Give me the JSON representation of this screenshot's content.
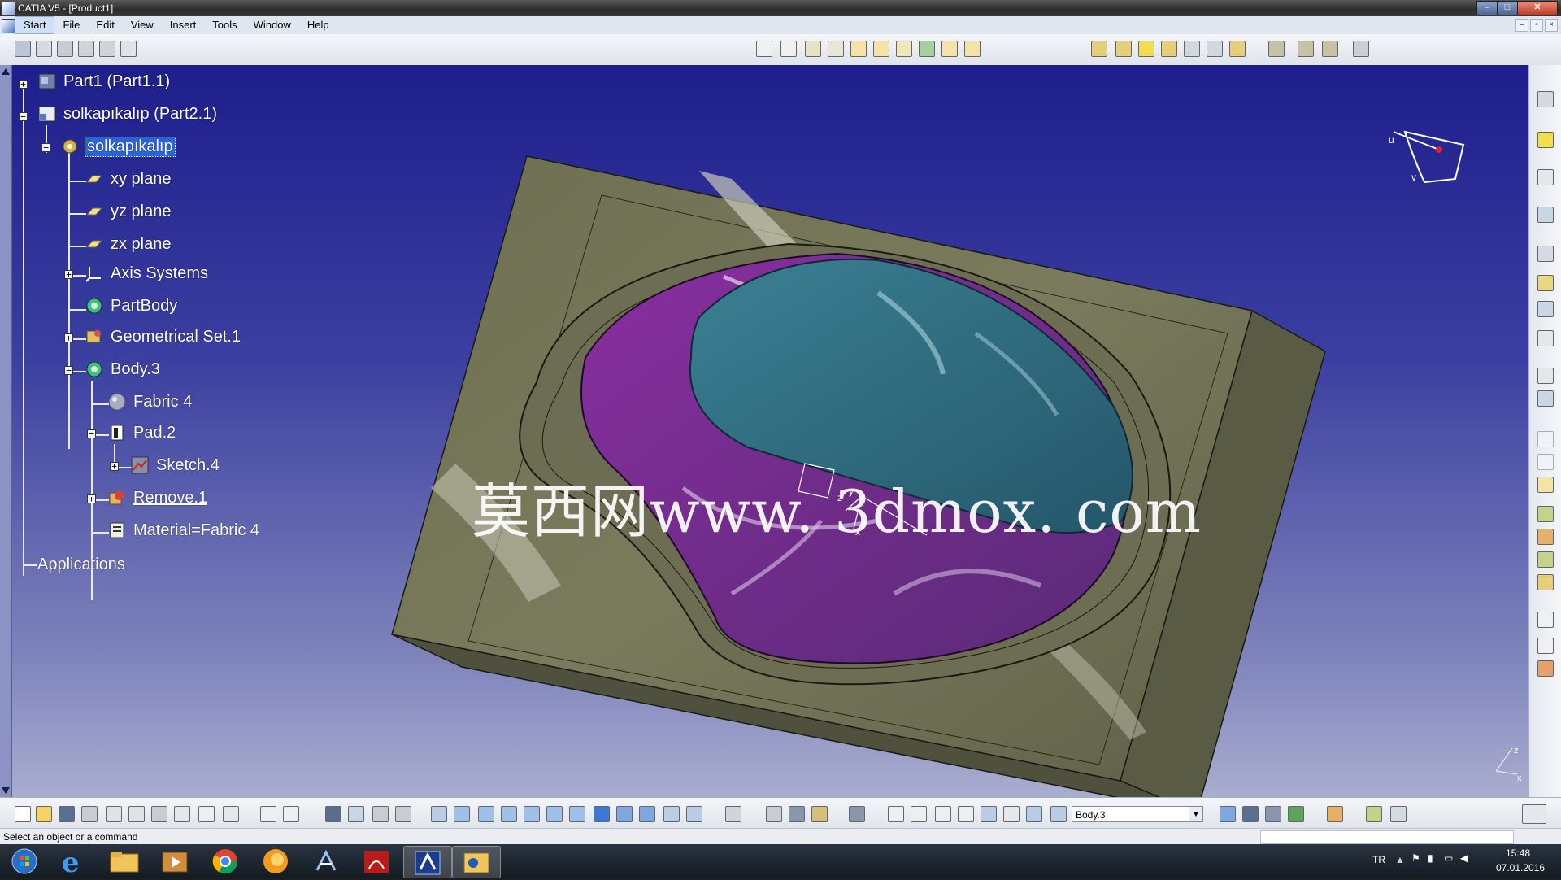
{
  "window": {
    "title": "CATIA V5 - [Product1]",
    "controls": {
      "minimize": "–",
      "maximize": "□",
      "close": "✕"
    }
  },
  "menu": {
    "items": [
      "Start",
      "File",
      "Edit",
      "View",
      "Insert",
      "Tools",
      "Window",
      "Help"
    ],
    "active": "Start"
  },
  "tree": {
    "nodes": [
      {
        "label": "Part1 (Part1.1)",
        "icon": "part-icon"
      },
      {
        "label": "solkapıkalıp (Part2.1)",
        "icon": "part-icon"
      },
      {
        "label": "solkapıkalıp",
        "icon": "part-body-gear-icon",
        "selected": true
      },
      {
        "label": "xy plane",
        "icon": "plane-icon"
      },
      {
        "label": "yz plane",
        "icon": "plane-icon"
      },
      {
        "label": "zx plane",
        "icon": "plane-icon"
      },
      {
        "label": "Axis Systems",
        "icon": "axis-system-icon"
      },
      {
        "label": "PartBody",
        "icon": "partbody-icon"
      },
      {
        "label": "Geometrical Set.1",
        "icon": "geometrical-set-icon"
      },
      {
        "label": "Body.3",
        "icon": "body-icon"
      },
      {
        "label": "Fabric 4",
        "icon": "material-sphere-icon"
      },
      {
        "label": "Pad.2",
        "icon": "pad-icon"
      },
      {
        "label": "Sketch.4",
        "icon": "sketch-icon"
      },
      {
        "label": "Remove.1",
        "icon": "remove-icon",
        "underlined": true
      },
      {
        "label": "Material=Fabric 4",
        "icon": "material-icon"
      },
      {
        "label": "Applications",
        "icon": ""
      }
    ]
  },
  "viewport": {
    "watermark": "莫西网www. 3dmox. com",
    "compass_axes": [
      "u",
      "v"
    ],
    "corner_axes": [
      "z",
      "x"
    ]
  },
  "bottom_toolbar": {
    "current_body": "Body.3"
  },
  "status": {
    "text": "Select an object or a command"
  },
  "taskbar": {
    "language": "TR",
    "time": "15:48",
    "date": "07.01.2016",
    "apps": [
      "start-orb",
      "internet-explorer",
      "file-explorer",
      "media-player",
      "chrome",
      "firefox",
      "catia-compass",
      "adobe-reader",
      "catia-v5",
      "outlook"
    ]
  },
  "colors": {
    "viewport_top": "#1e1e8c",
    "viewport_bottom": "#a9adcf",
    "mold_block": "#737457",
    "cavity_surface": "#7a2f8c",
    "pad_surface": "#2f6c80",
    "selection": "#2b63d9"
  }
}
